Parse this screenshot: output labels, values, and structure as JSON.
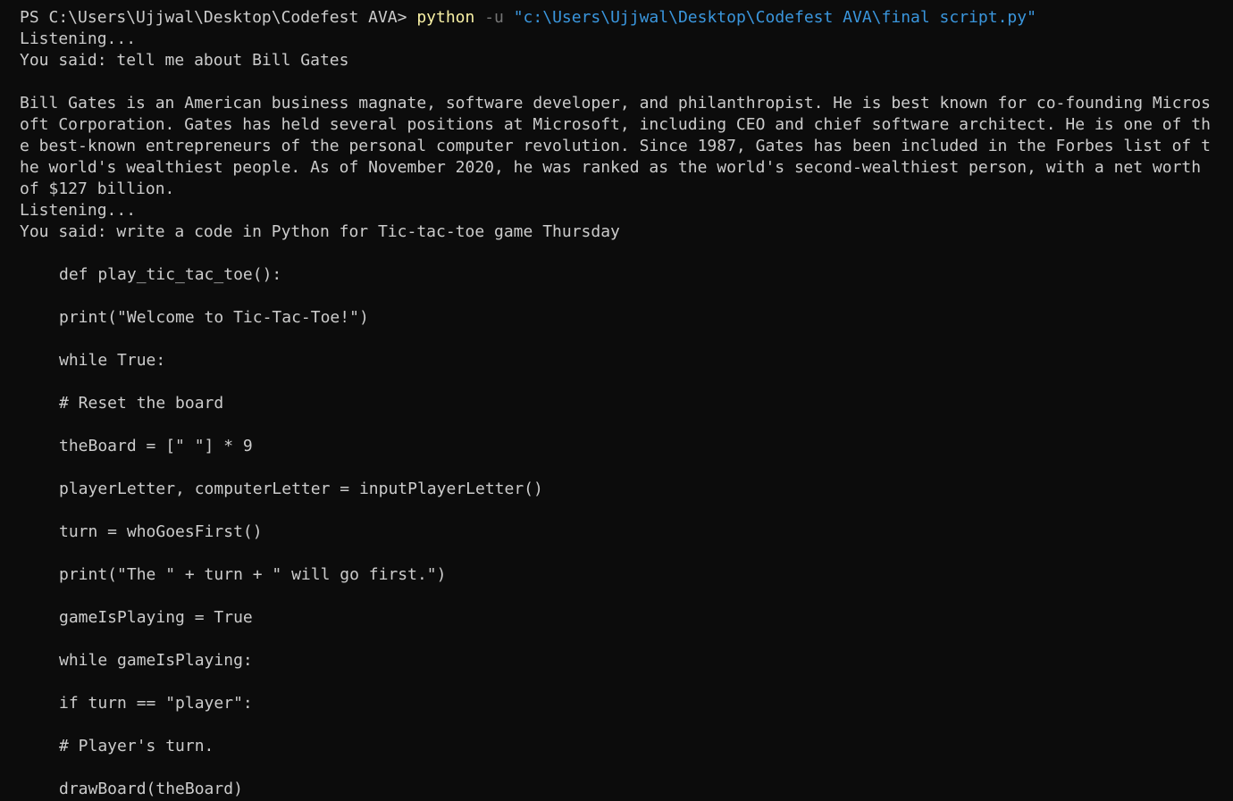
{
  "terminal": {
    "prompt": {
      "path": "PS C:\\Users\\Ujjwal\\Desktop\\Codefest AVA> ",
      "command": "python",
      "flag": " -u ",
      "argument": "\"c:\\Users\\Ujjwal\\Desktop\\Codefest AVA\\final script.py\""
    },
    "output_lines": [
      "Listening...",
      "You said: tell me about Bill Gates",
      "",
      "Bill Gates is an American business magnate, software developer, and philanthropist. He is best known for co-founding Micros",
      "oft Corporation. Gates has held several positions at Microsoft, including CEO and chief software architect. He is one of th",
      "e best-known entrepreneurs of the personal computer revolution. Since 1987, Gates has been included in the Forbes list of t",
      "he world's wealthiest people. As of November 2020, he was ranked as the world's second-wealthiest person, with a net worth",
      "of $127 billion.",
      "Listening...",
      "You said: write a code in Python for Tic-tac-toe game Thursday"
    ],
    "code_lines": [
      "def play_tic_tac_toe():",
      "print(\"Welcome to Tic-Tac-Toe!\")",
      "while True:",
      "# Reset the board",
      "theBoard = [\" \"] * 9",
      "playerLetter, computerLetter = inputPlayerLetter()",
      "turn = whoGoesFirst()",
      "print(\"The \" + turn + \" will go first.\")",
      "gameIsPlaying = True",
      "while gameIsPlaying:",
      "if turn == \"player\":",
      "# Player's turn.",
      "drawBoard(theBoard)"
    ],
    "colors": {
      "background": "#0c0c0c",
      "foreground": "#cccccc",
      "command": "#f9f1a5",
      "flag": "#767676",
      "string": "#3a96dd"
    }
  }
}
